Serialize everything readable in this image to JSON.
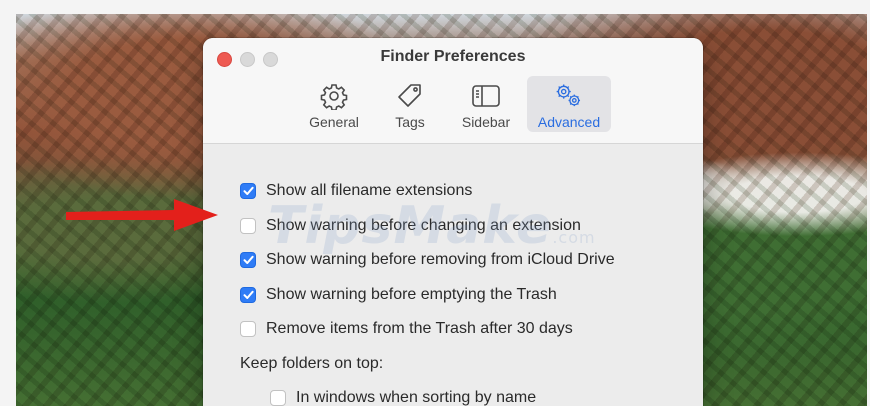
{
  "window": {
    "title": "Finder Preferences"
  },
  "toolbar": {
    "tabs": [
      {
        "label": "General",
        "icon": "gear-icon"
      },
      {
        "label": "Tags",
        "icon": "tag-icon"
      },
      {
        "label": "Sidebar",
        "icon": "sidebar-icon"
      },
      {
        "label": "Advanced",
        "icon": "gears-icon",
        "selected": true
      }
    ]
  },
  "options": [
    {
      "label": "Show all filename extensions",
      "checked": true
    },
    {
      "label": "Show warning before changing an extension",
      "checked": false
    },
    {
      "label": "Show warning before removing from iCloud Drive",
      "checked": true
    },
    {
      "label": "Show warning before emptying the Trash",
      "checked": true
    },
    {
      "label": "Remove items from the Trash after 30 days",
      "checked": false
    }
  ],
  "keep_folders": {
    "heading": "Keep folders on top:",
    "options": [
      {
        "label": "In windows when sorting by name",
        "checked": false
      }
    ]
  },
  "watermark": {
    "text": "TipsMake",
    "suffix": ".com"
  },
  "colors": {
    "accent": "#2f7cf6",
    "close_button": "#ee5a52",
    "arrow": "#e3201b"
  }
}
